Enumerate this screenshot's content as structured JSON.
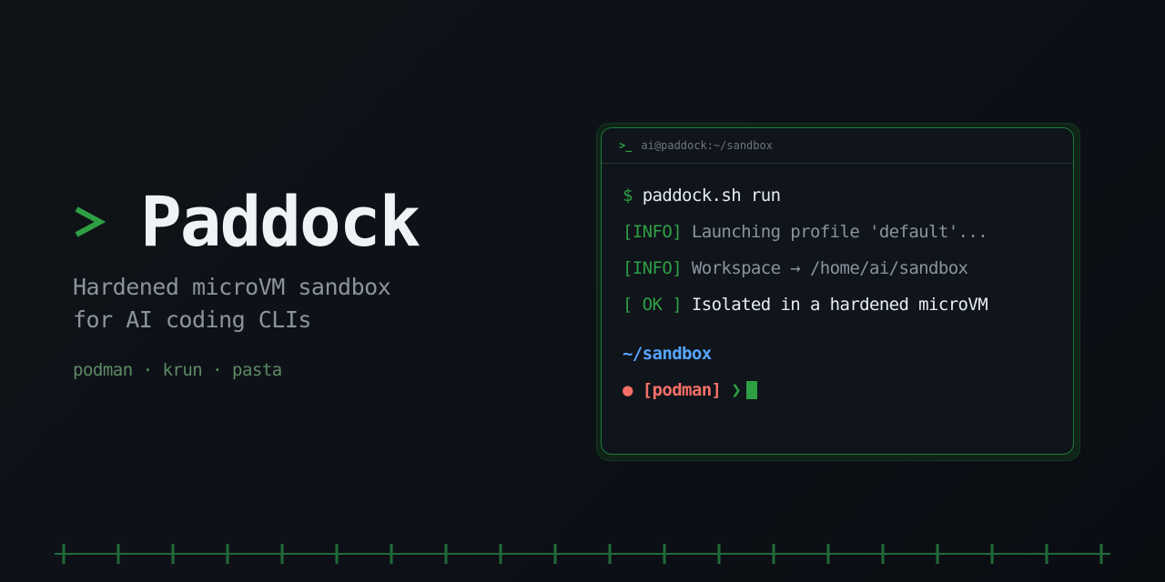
{
  "brand": {
    "title": "Paddock",
    "tagline_line1": "Hardened microVM sandbox",
    "tagline_line2": "for AI coding CLIs",
    "stack": "podman · krun · pasta"
  },
  "terminal": {
    "header_prompt": ">_",
    "header_title": "ai@paddock:~/sandbox",
    "lines": [
      {
        "prefix": "$",
        "text": "paddock.sh run"
      },
      {
        "prefix": "[INFO]",
        "text": "Launching profile 'default'..."
      },
      {
        "prefix": "[INFO]",
        "text": "Workspace → /home/ai/sandbox"
      },
      {
        "prefix": "[ OK ]",
        "text": "Isolated in a hardened microVM"
      }
    ],
    "cwd": "~/sandbox",
    "status_dot": "●",
    "context": "[podman]",
    "prompt_char": "❯"
  },
  "colors": {
    "accent_green": "#2ea043",
    "path_blue": "#58a6ff",
    "context_red": "#f47067",
    "background": "#0d1117"
  },
  "icons": {
    "brand_prompt": "chevron-right-icon",
    "header_prompt": "terminal-prompt-icon",
    "cursor": "block-cursor-icon"
  }
}
